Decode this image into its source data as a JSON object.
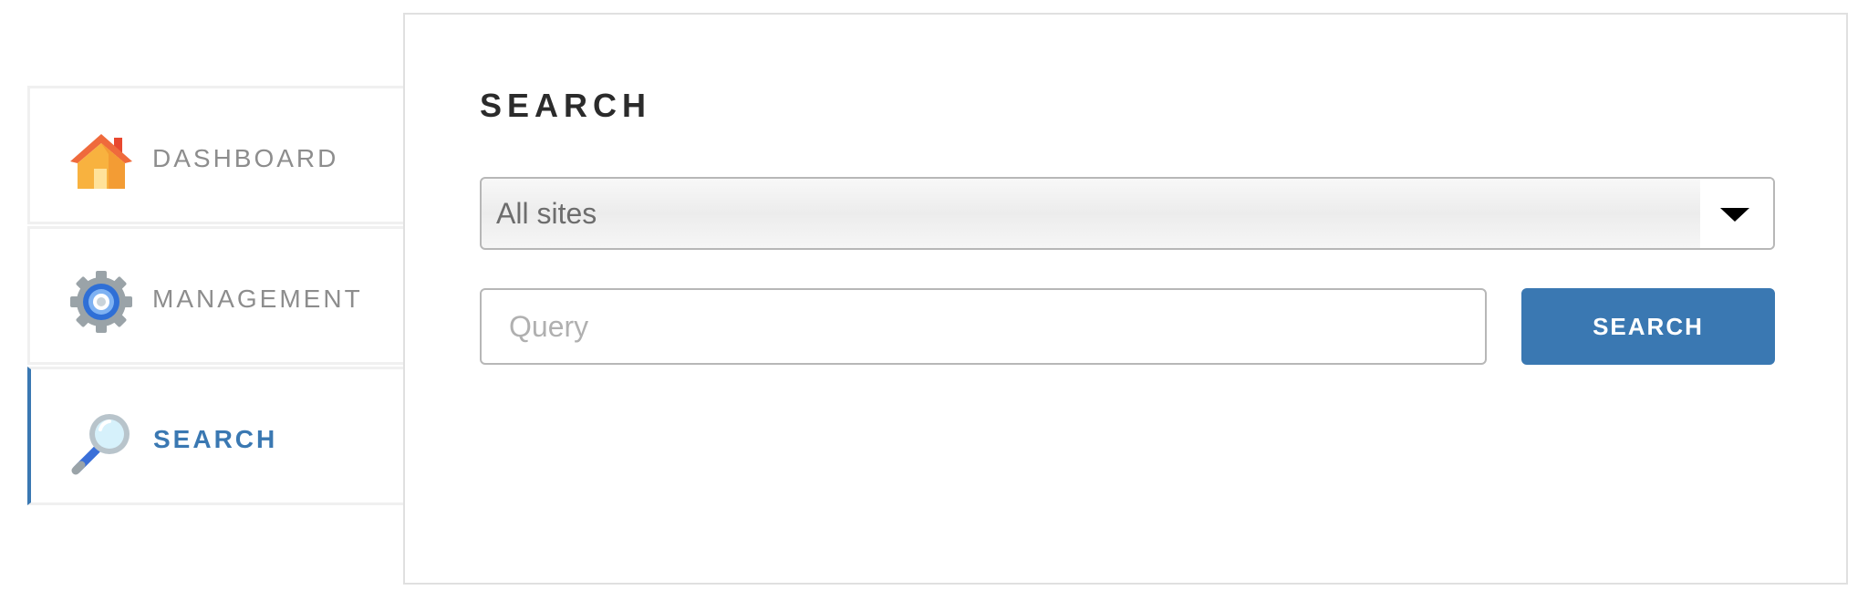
{
  "sidebar": {
    "items": [
      {
        "label": "DASHBOARD",
        "icon": "house-icon",
        "active": false
      },
      {
        "label": "MANAGEMENT",
        "icon": "gear-icon",
        "active": false
      },
      {
        "label": "SEARCH",
        "icon": "magnifier-icon",
        "active": true
      }
    ],
    "accent_color": "#3a78b2"
  },
  "main": {
    "title": "SEARCH",
    "site_select": {
      "value": "All sites"
    },
    "query": {
      "value": "",
      "placeholder": "Query"
    },
    "search_button": {
      "label": "SEARCH"
    }
  }
}
